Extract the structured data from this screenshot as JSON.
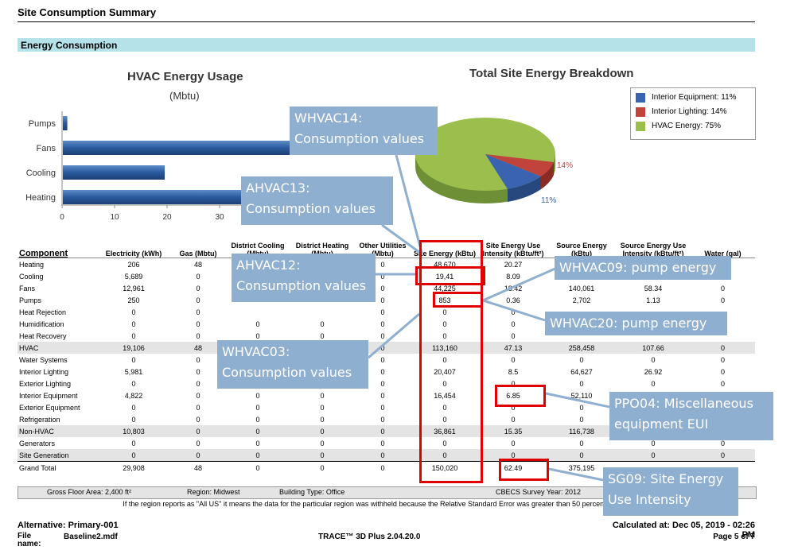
{
  "page": {
    "title": "Site Consumption Summary",
    "section": "Energy Consumption"
  },
  "hvac_chart": {
    "title": "HVAC Energy Usage",
    "subtitle": "(Mbtu)",
    "categories": [
      "Pumps",
      "Fans",
      "Cooling",
      "Heating"
    ],
    "ticks": [
      "0",
      "10",
      "20",
      "30"
    ]
  },
  "pie_chart": {
    "title": "Total Site Energy Breakdown",
    "legend": [
      "Interior Equipment: 11%",
      "Interior Lighting: 14%",
      "HVAC Energy: 75%"
    ],
    "labels": [
      "14%",
      "11%"
    ],
    "colors": [
      "#3a64b0",
      "#c0443c",
      "#9bbe4c"
    ]
  },
  "chart_data": [
    {
      "type": "bar",
      "title": "HVAC Energy Usage",
      "xlabel": "(Mbtu)",
      "categories": [
        "Pumps",
        "Fans",
        "Cooling",
        "Heating"
      ],
      "values": [
        0.85,
        44.2,
        19.4,
        48.7
      ],
      "xlim": [
        0,
        35
      ]
    },
    {
      "type": "pie",
      "title": "Total Site Energy Breakdown",
      "categories": [
        "Interior Equipment",
        "Interior Lighting",
        "HVAC Energy"
      ],
      "values": [
        11,
        14,
        75
      ]
    }
  ],
  "table": {
    "headers": [
      "Component",
      "Electricity (kWh)",
      "Gas (Mbtu)",
      "District Cooling (Mbtu)",
      "District Heating (Mbtu)",
      "Other Utilities (Mbtu)",
      "Site Energy (kBtu)",
      "Site Energy Use Intensity (kBtu/ft²)",
      "Source Energy (kBtu)",
      "Source Energy Use Intensity (kBtu/ft²)",
      "Water (gal)"
    ],
    "rows": [
      {
        "c": [
          "Heating",
          "206",
          "48",
          "",
          "",
          "0",
          "48,670",
          "20.27",
          "",
          "",
          ""
        ]
      },
      {
        "c": [
          "Cooling",
          "5,689",
          "0",
          "",
          "",
          "0",
          "19,41",
          "8.09",
          "",
          "",
          ""
        ]
      },
      {
        "c": [
          "Fans",
          "12,961",
          "0",
          "",
          "",
          "0",
          "44,225",
          "18.42",
          "140,061",
          "58.34",
          "0"
        ]
      },
      {
        "c": [
          "Pumps",
          "250",
          "0",
          "",
          "",
          "0",
          "853",
          "0.36",
          "2,702",
          "1.13",
          "0"
        ]
      },
      {
        "c": [
          "Heat Rejection",
          "0",
          "0",
          "",
          "",
          "0",
          "0",
          "0",
          "",
          "",
          ""
        ]
      },
      {
        "c": [
          "Humidification",
          "0",
          "0",
          "0",
          "0",
          "0",
          "0",
          "0",
          "",
          "",
          ""
        ]
      },
      {
        "c": [
          "Heat Recovery",
          "0",
          "0",
          "0",
          "0",
          "0",
          "0",
          "0",
          "",
          "",
          ""
        ]
      },
      {
        "c": [
          "HVAC",
          "19,106",
          "48",
          "",
          "",
          "0",
          "113,160",
          "47.13",
          "258,458",
          "107.66",
          "0"
        ],
        "shade": true
      },
      {
        "c": [
          "Water Systems",
          "0",
          "0",
          "",
          "",
          "0",
          "0",
          "0",
          "0",
          "0",
          "0"
        ]
      },
      {
        "c": [
          "Interior Lighting",
          "5,981",
          "0",
          "",
          "",
          "0",
          "20,407",
          "8.5",
          "64,627",
          "26.92",
          "0"
        ]
      },
      {
        "c": [
          "Exterior Lighting",
          "0",
          "0",
          "",
          "",
          "0",
          "0",
          "0",
          "0",
          "0",
          "0"
        ]
      },
      {
        "c": [
          "Interior Equipment",
          "4,822",
          "0",
          "0",
          "0",
          "0",
          "16,454",
          "6.85",
          "52,110",
          "",
          "0"
        ]
      },
      {
        "c": [
          "Exterior Equipment",
          "0",
          "0",
          "0",
          "0",
          "0",
          "0",
          "0",
          "0",
          "",
          ""
        ]
      },
      {
        "c": [
          "Refrigeration",
          "0",
          "0",
          "0",
          "0",
          "0",
          "0",
          "0",
          "0",
          "",
          ""
        ]
      },
      {
        "c": [
          "Non-HVAC",
          "10,803",
          "0",
          "0",
          "0",
          "0",
          "36,861",
          "15.35",
          "116,738",
          "",
          ""
        ],
        "shade": true
      },
      {
        "c": [
          "Generators",
          "0",
          "0",
          "0",
          "0",
          "0",
          "0",
          "0",
          "0",
          "0",
          "0"
        ]
      },
      {
        "c": [
          "Site Generation",
          "0",
          "0",
          "0",
          "0",
          "0",
          "0",
          "0",
          "0",
          "0",
          "0"
        ],
        "shade": true
      },
      {
        "c": [
          "Grand Total",
          "29,908",
          "48",
          "0",
          "0",
          "0",
          "150,020",
          "62.49",
          "375,195",
          "",
          ""
        ],
        "total": true
      }
    ]
  },
  "info": {
    "floor_area": "Gross Floor Area: 2,400 ft²",
    "region": "Region: Midwest",
    "building_type": "Building Type: Office",
    "cbecs": "CBECS Survey Year: 2012",
    "footnote": "If the region reports as \"All US\" it means the data for the particular region was withheld because the Relative Standard Error was greater than 50 percent or fewer than"
  },
  "footer": {
    "alternative": "Alternative: Primary-001",
    "file_label": "File name:",
    "file_value": "Baseline2.mdf",
    "product": "TRACE™ 3D Plus 2.04.20.0",
    "calculated": "Calculated at: Dec 05, 2019 - 02:26 PM",
    "page": "Page 5 of 7"
  },
  "callouts": {
    "whvac14": "WHVAC14: Consumption values",
    "ahvac13": "AHVAC13: Consumption values",
    "ahvac12": "AHVAC12: Consumption values",
    "whvac09": "WHVAC09: pump energy",
    "whvac20": "WHVAC20: pump energy",
    "whvac03": "WHVAC03: Consumption values",
    "ppo04": "PPO04: Miscellaneous equipment EUI",
    "sg09": "SG09: Site Energy Use Intensity"
  }
}
